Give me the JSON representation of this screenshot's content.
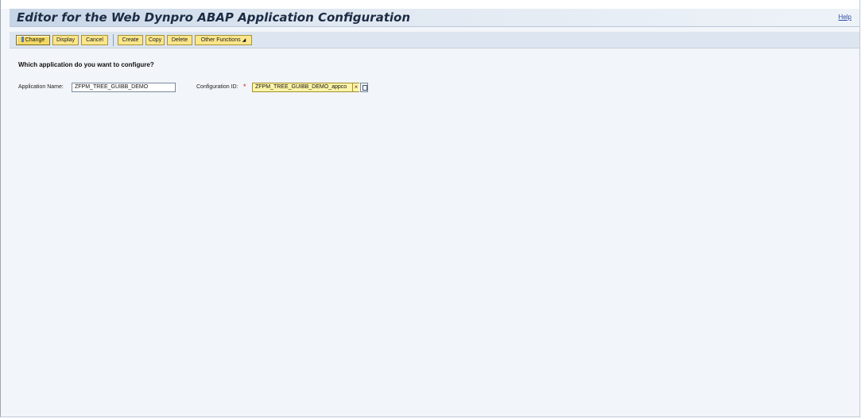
{
  "header": {
    "title": "Editor for the Web Dynpro ABAP Application Configuration",
    "help_label": "Help"
  },
  "toolbar": {
    "change_label": "Change",
    "display_label": "Display",
    "cancel_label": "Cancel",
    "create_label": "Create",
    "copy_label": "Copy",
    "delete_label": "Delete",
    "other_functions_label": "Other Functions"
  },
  "form": {
    "question": "Which application do you want to configure?",
    "application_name_label": "Application Name:",
    "application_name_value": "ZFPM_TREE_GUIBB_DEMO",
    "configuration_id_label": "Configuration ID:",
    "configuration_id_value": "ZFPM_TREE_GUIBB_DEMO_appco",
    "required_marker": "*",
    "clear_symbol": "×"
  },
  "colors": {
    "button_bg": "#fce68a",
    "required_field_bg": "#fff5a8",
    "title_text": "#1c2c44",
    "required_marker": "#d42020"
  },
  "icons": {
    "other_functions": "triangle-down-icon",
    "value_help": "value-help-icon",
    "clear": "clear-icon"
  }
}
